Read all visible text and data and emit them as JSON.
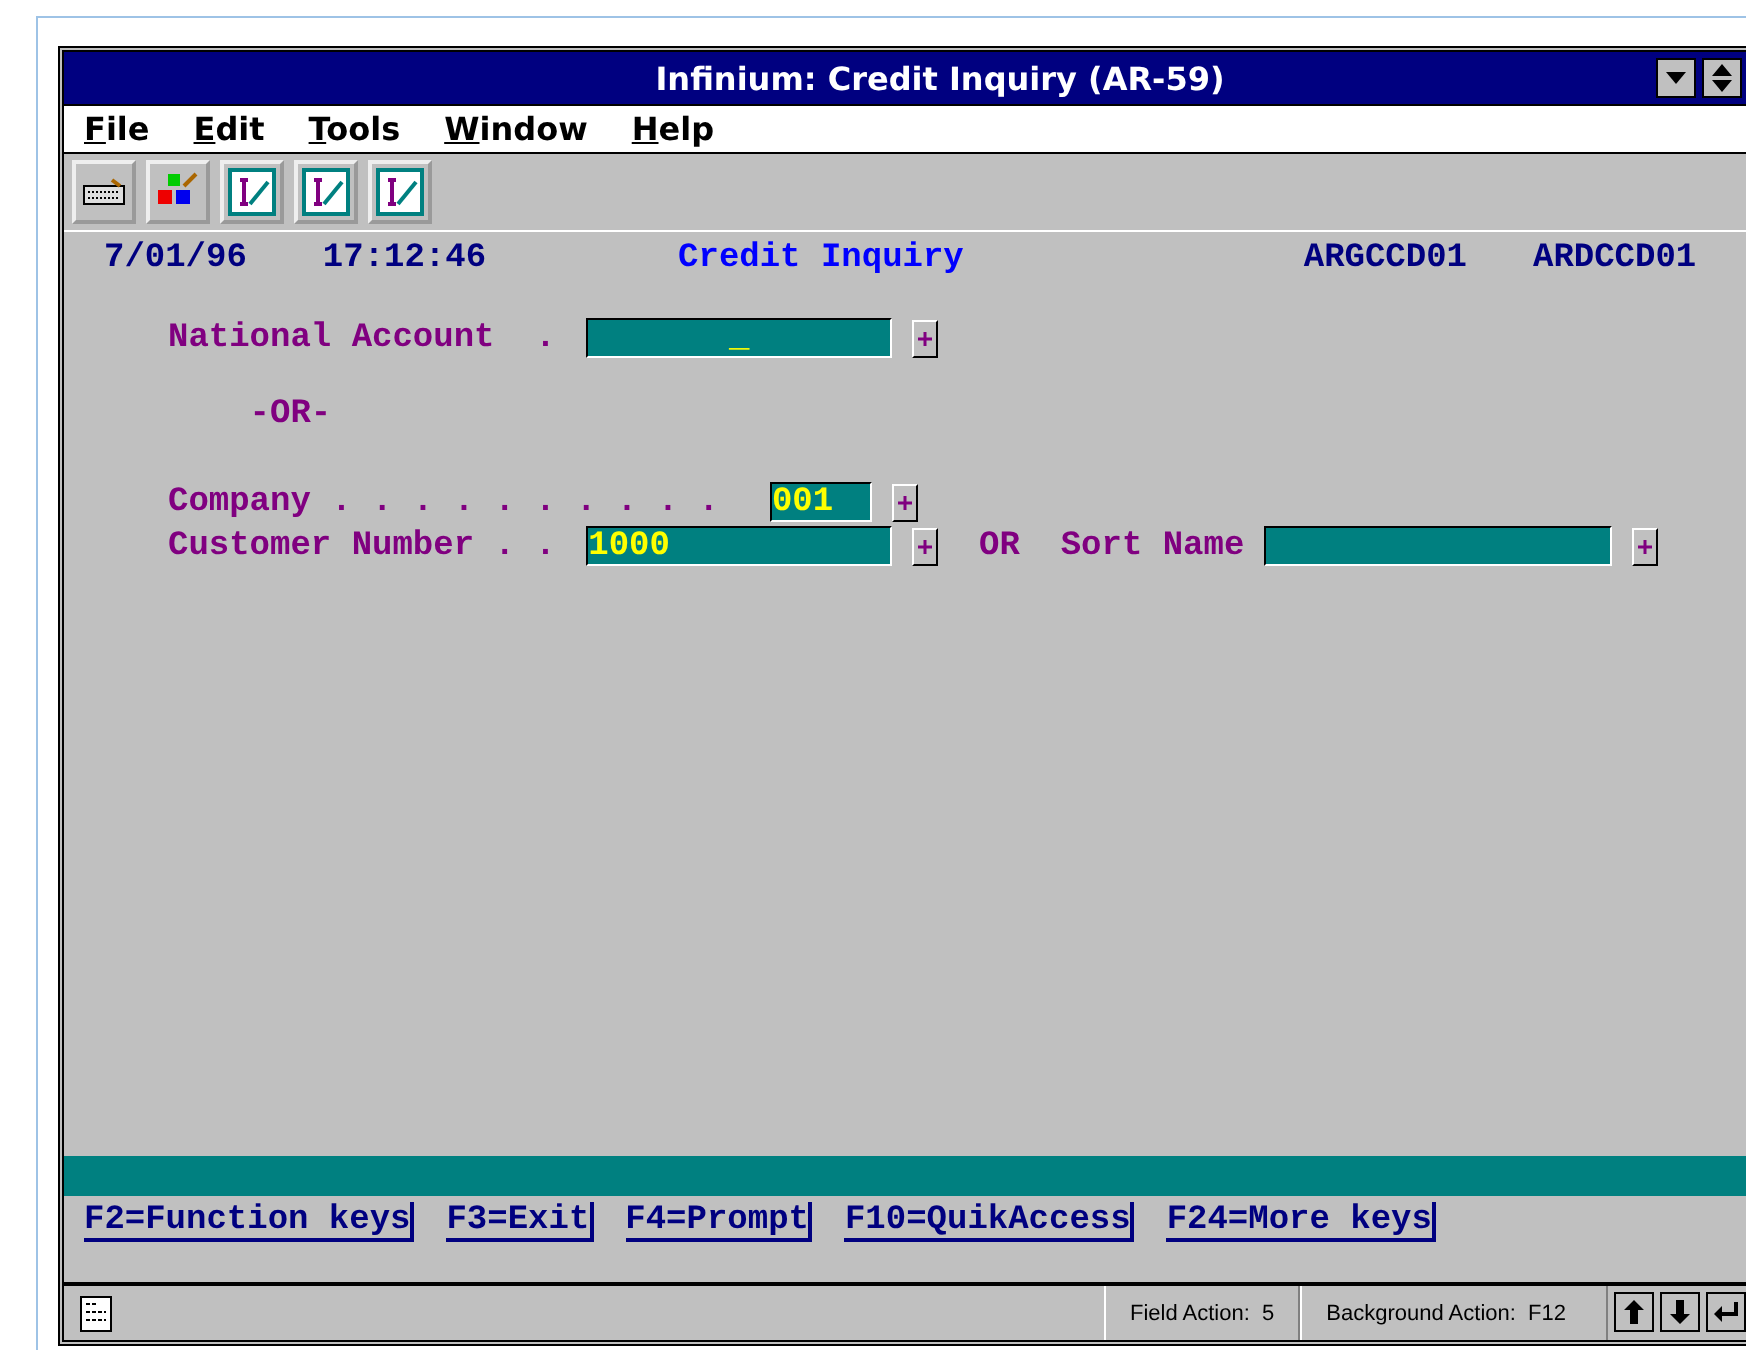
{
  "window": {
    "title": "Infinium: Credit Inquiry (AR-59)"
  },
  "menu": [
    "File",
    "Edit",
    "Tools",
    "Window",
    "Help"
  ],
  "toolbar": [
    {
      "kind": "keyboard"
    },
    {
      "kind": "palette"
    },
    {
      "kind": "form"
    },
    {
      "kind": "form"
    },
    {
      "kind": "form"
    }
  ],
  "header": {
    "date": "7/01/96",
    "time": "17:12:46",
    "title": "Credit Inquiry",
    "code_1": "ARGCCD01",
    "code_2": "ARDCCD01"
  },
  "form": [
    {
      "kind": "account",
      "label": "National Account  .",
      "value": "_"
    },
    {
      "kind": "separator",
      "label": "-OR-"
    },
    {
      "kind": "company",
      "label": "Company . . . . . . . . . .",
      "value": "001"
    },
    {
      "kind": "customer",
      "label": "Customer Number . .",
      "value": "1000",
      "alt_label": "OR  Sort Name"
    }
  ],
  "function_keys": [
    "F2=Function keys",
    "F3=Exit",
    "F4=Prompt",
    "F10=QuikAccess",
    "F24=More keys"
  ],
  "status_bar": {
    "field_action": "Field Action:  5",
    "background_action": "Background Action:  F12"
  }
}
